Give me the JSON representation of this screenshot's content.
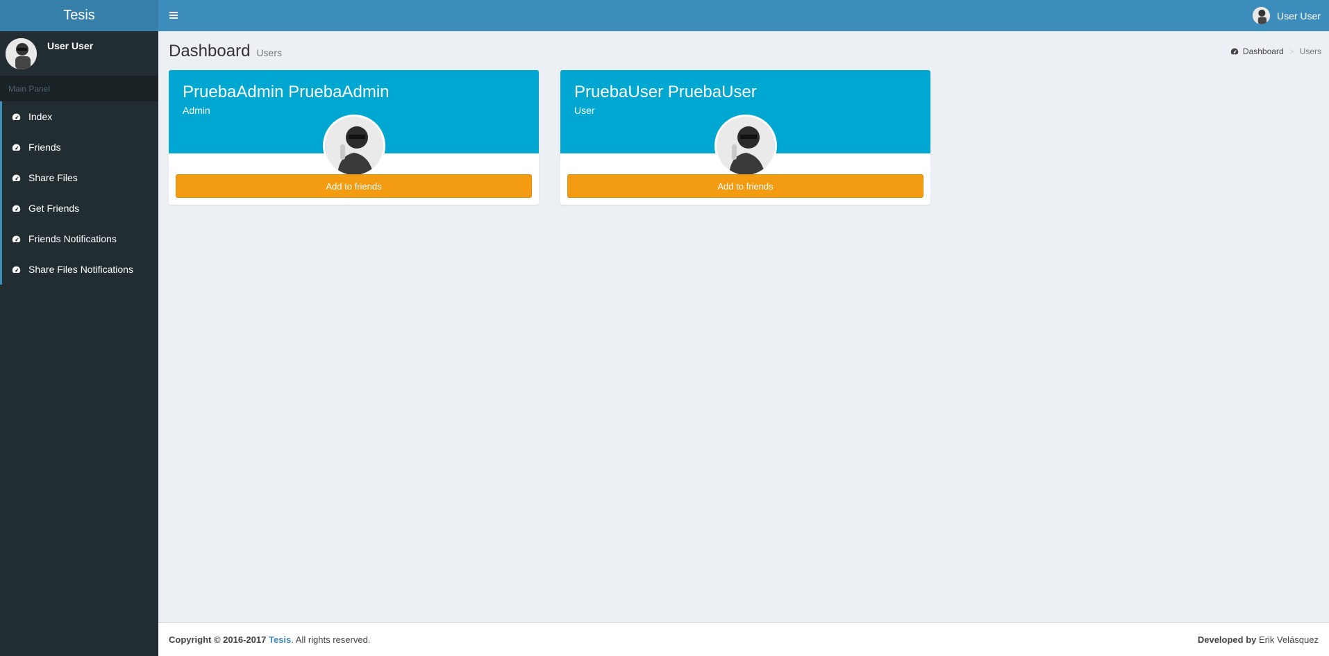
{
  "app": {
    "logo": "Tesis",
    "colors": {
      "header": "#3c8dbc",
      "sidebar": "#222d32",
      "card_head": "#00a7d0",
      "button": "#f39c12"
    }
  },
  "sidebar": {
    "user_name": "User User",
    "section_header": "Main Panel",
    "items": [
      {
        "label": "Index",
        "icon": "dashboard-icon"
      },
      {
        "label": "Friends",
        "icon": "dashboard-icon"
      },
      {
        "label": "Share Files",
        "icon": "dashboard-icon"
      },
      {
        "label": "Get Friends",
        "icon": "dashboard-icon"
      },
      {
        "label": "Friends Notifications",
        "icon": "dashboard-icon"
      },
      {
        "label": "Share Files Notifications",
        "icon": "dashboard-icon"
      }
    ]
  },
  "header": {
    "user_name": "User User",
    "toggle_icon": "hamburger-icon"
  },
  "page": {
    "title": "Dashboard",
    "subtitle": "Users",
    "breadcrumb": {
      "home": "Dashboard",
      "current": "Users"
    }
  },
  "cards": [
    {
      "name": "PruebaAdmin PruebaAdmin",
      "role": "Admin",
      "button": "Add to friends"
    },
    {
      "name": "PruebaUser PruebaUser",
      "role": "User",
      "button": "Add to friends"
    }
  ],
  "footer": {
    "copyright_prefix": "Copyright © 2016-2017",
    "copyright_link": "Tesis",
    "copyright_suffix": ". All rights reserved.",
    "developed_label": "Developed by",
    "developer": "Erik Velásquez"
  }
}
